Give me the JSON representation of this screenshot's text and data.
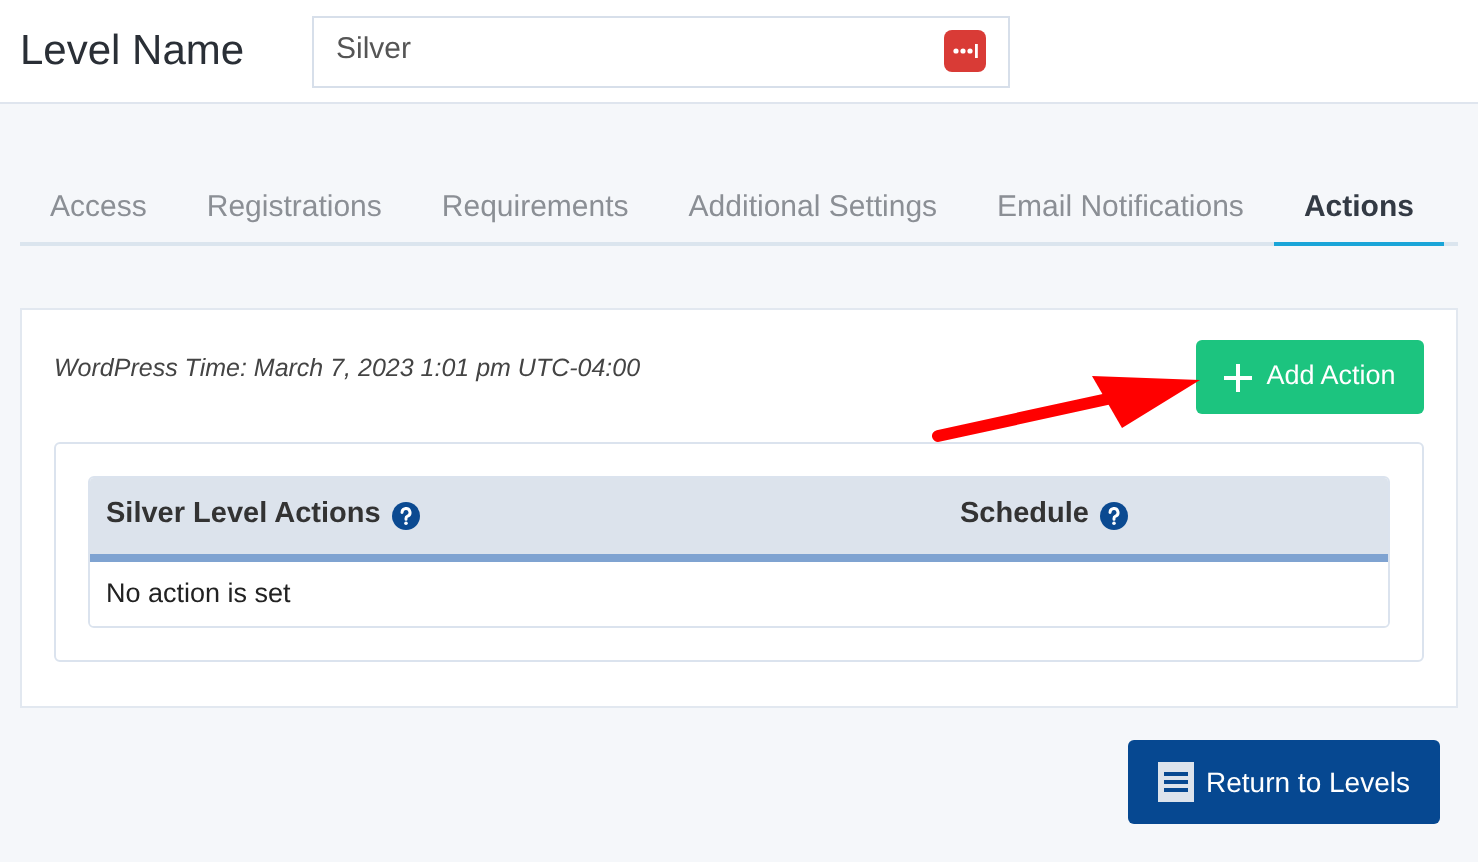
{
  "header": {
    "title": "Level Name",
    "name_field": {
      "value": "Silver"
    }
  },
  "tabs": [
    {
      "label": "Access",
      "selected": false
    },
    {
      "label": "Registrations",
      "selected": false
    },
    {
      "label": "Requirements",
      "selected": false
    },
    {
      "label": "Additional Settings",
      "selected": false
    },
    {
      "label": "Email Notifications",
      "selected": false
    },
    {
      "label": "Actions",
      "selected": true
    }
  ],
  "panel": {
    "wordpress_time": "WordPress Time: March 7, 2023 1:01 pm UTC-04:00",
    "add_button": "Add Action",
    "table": {
      "columns": [
        "Silver Level Actions",
        "Schedule"
      ],
      "empty_message": "No action is set"
    }
  },
  "footer": {
    "return_button": "Return to Levels"
  }
}
